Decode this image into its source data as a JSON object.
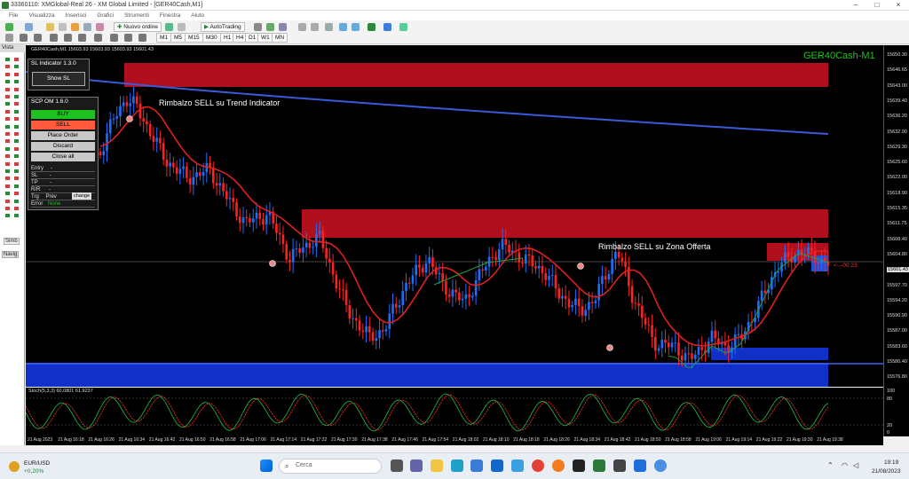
{
  "window": {
    "title": "33360110: XMGlobal-Real 26 - XM Global Limited - [GER40Cash,M1]"
  },
  "menu": [
    "File",
    "Visualizza",
    "Inserisci",
    "Grafici",
    "Strumenti",
    "Finestra",
    "Aiuto"
  ],
  "toolbar": {
    "new_order": "Nuovo ordine",
    "autotrading": "AutoTrading",
    "timeframes": [
      "M1",
      "M5",
      "M15",
      "M30",
      "H1",
      "H4",
      "D1",
      "W1",
      "MN"
    ]
  },
  "left_panel": {
    "header": "Vista",
    "tab_symbols": "Simb",
    "tab_navigator": "Navig"
  },
  "chart": {
    "header": "GER40Cash,M1  15603.93 15603.93 15603.93 15601.43",
    "symbol_label": "GER40Cash-M1",
    "annotation_trend": "Rimbalzo SELL su Trend Indicator",
    "annotation_zone": "Rimbalzo SELL su Zona Offerta",
    "countdown": "<---00:23",
    "current_price": "15601.43",
    "colors": {
      "bull": "#1a6fff",
      "bear": "#ff2020",
      "zone_supply": "#b0101e",
      "zone_demand": "#1030c8",
      "ma_slow": "#3a5bd8",
      "ma_fast": "#e02020"
    }
  },
  "sl_indicator": {
    "title": "SL Indicator 1.3.0",
    "show_button": "Show SL"
  },
  "scp_panel": {
    "title": "SCP OM 1.6.0",
    "buy": "BUY",
    "sell": "SELL",
    "place_order": "Place Order",
    "discard": "Discard",
    "close_all": "Close all",
    "fields": [
      "Entry",
      "SL",
      "TP",
      "R/R",
      "Trg",
      "Error"
    ],
    "field_values": [
      "-",
      "-",
      "-",
      "-",
      "Prev",
      ""
    ],
    "change_button": "change",
    "error_value": "None"
  },
  "stochastic": {
    "header": "Stoch(5,3,3) 60.0801 61.9237",
    "levels": [
      "100",
      "80",
      "20",
      "0"
    ]
  },
  "price_axis": [
    "15650.30",
    "15646.65",
    "15643.00",
    "15639.40",
    "15636.20",
    "15632.90",
    "15629.30",
    "15625.60",
    "15622.00",
    "15618.90",
    "15615.35",
    "15611.75",
    "15608.40",
    "15604.80",
    "15601.43",
    "15597.70",
    "15594.20",
    "15590.90",
    "15587.00",
    "15583.60",
    "15580.40",
    "15576.80"
  ],
  "time_axis": [
    "21 Aug 2023",
    "21 Aug 16:18",
    "21 Aug 16:26",
    "21 Aug 16:34",
    "21 Aug 16:42",
    "21 Aug 16:50",
    "21 Aug 16:58",
    "21 Aug 17:06",
    "21 Aug 17:14",
    "21 Aug 17:22",
    "21 Aug 17:30",
    "21 Aug 17:38",
    "21 Aug 17:46",
    "21 Aug 17:54",
    "21 Aug 18:02",
    "21 Aug 18:10",
    "21 Aug 18:18",
    "21 Aug 18:26",
    "21 Aug 18:34",
    "21 Aug 18:42",
    "21 Aug 18:50",
    "21 Aug 18:58",
    "21 Aug 19:06",
    "21 Aug 19:14",
    "21 Aug 19:22",
    "21 Aug 19:30",
    "21 Aug 19:38"
  ],
  "taskbar": {
    "ticker_symbol": "EUR/USD",
    "ticker_change": "+0,20%",
    "search_placeholder": "Cerca",
    "time": "19:19",
    "date": "21/08/2023"
  }
}
